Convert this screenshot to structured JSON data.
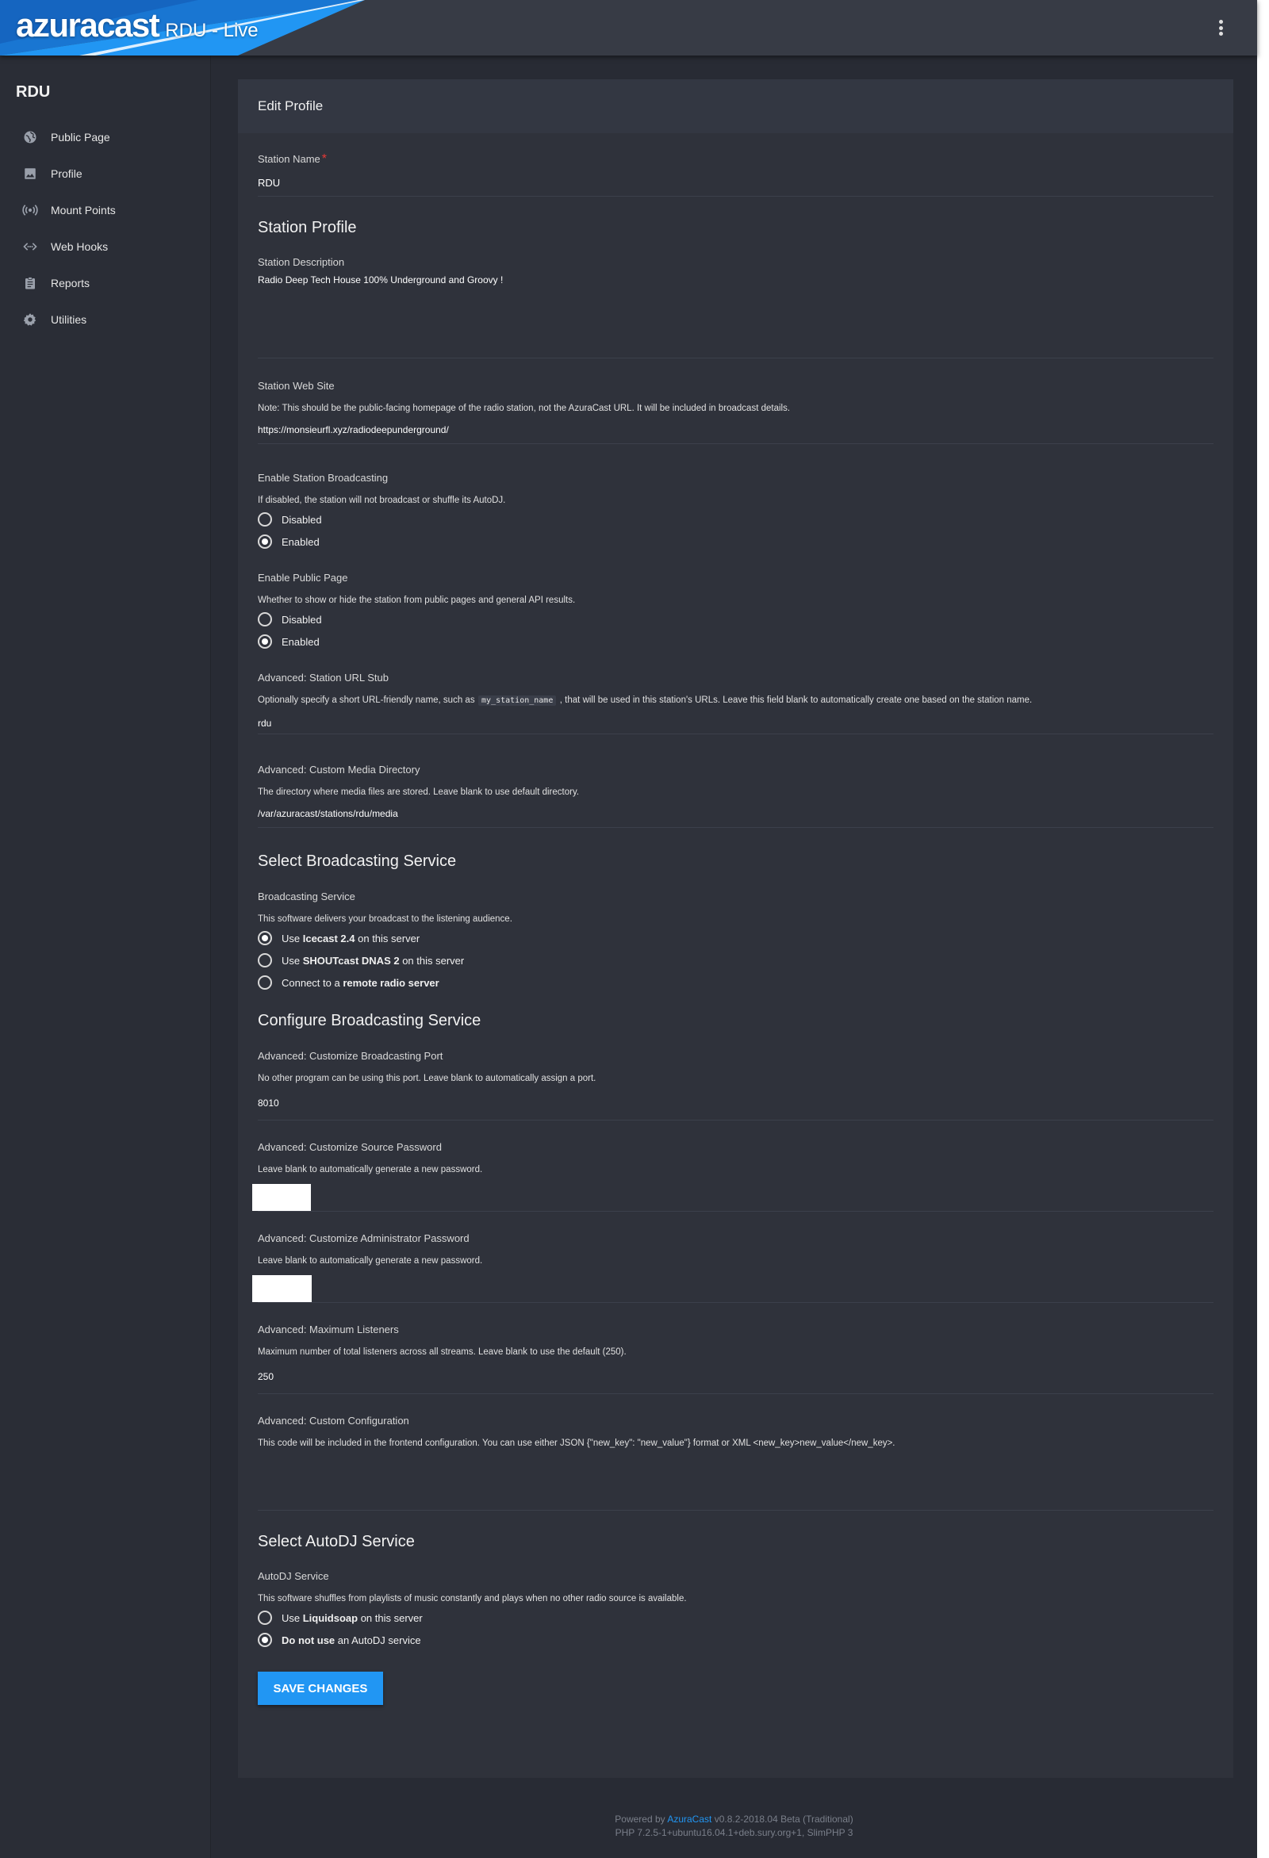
{
  "header": {
    "logo": "azuracast",
    "title": "RDU - Live",
    "menu_icon": "more-vert-icon"
  },
  "sidebar": {
    "station_name": "RDU",
    "items": [
      {
        "label": "Public Page",
        "icon": "globe-icon"
      },
      {
        "label": "Profile",
        "icon": "image-icon"
      },
      {
        "label": "Mount Points",
        "icon": "broadcast-icon"
      },
      {
        "label": "Web Hooks",
        "icon": "code-arrows-icon"
      },
      {
        "label": "Reports",
        "icon": "clipboard-icon"
      },
      {
        "label": "Utilities",
        "icon": "gear-icon"
      }
    ]
  },
  "form": {
    "panel_title": "Edit Profile",
    "station_name": {
      "label": "Station Name",
      "required_mark": "*",
      "value": "RDU"
    },
    "station_profile_title": "Station Profile",
    "description": {
      "label": "Station Description",
      "value": "Radio Deep Tech House 100% Underground and Groovy !"
    },
    "website": {
      "label": "Station Web Site",
      "help": "Note: This should be the public-facing homepage of the radio station, not the AzuraCast URL. It will be included in broadcast details.",
      "value": "https://monsieurfl.xyz/radiodeepunderground/"
    },
    "broadcasting": {
      "label": "Enable Station Broadcasting",
      "help": "If disabled, the station will not broadcast or shuffle its AutoDJ.",
      "options": [
        "Disabled",
        "Enabled"
      ],
      "selected": "Enabled"
    },
    "public_page": {
      "label": "Enable Public Page",
      "help": "Whether to show or hide the station from public pages and general API results.",
      "options": [
        "Disabled",
        "Enabled"
      ],
      "selected": "Enabled"
    },
    "url_stub": {
      "label": "Advanced: Station URL Stub",
      "help_before": "Optionally specify a short URL-friendly name, such as",
      "help_code": "my_station_name",
      "help_after": ", that will be used in this station's URLs. Leave this field blank to automatically create one based on the station name.",
      "value": "rdu"
    },
    "media_dir": {
      "label": "Advanced: Custom Media Directory",
      "help": "The directory where media files are stored. Leave blank to use default directory.",
      "value": "/var/azuracast/stations/rdu/media"
    },
    "select_broadcasting_title": "Select Broadcasting Service",
    "broadcast_service": {
      "label": "Broadcasting Service",
      "help": "This software delivers your broadcast to the listening audience.",
      "options": [
        {
          "prefix": "Use ",
          "bold": "Icecast 2.4",
          "suffix": " on this server"
        },
        {
          "prefix": "Use ",
          "bold": "SHOUTcast DNAS 2",
          "suffix": " on this server"
        },
        {
          "prefix": "Connect to a ",
          "bold": "remote radio server",
          "suffix": ""
        }
      ],
      "selected_index": 0
    },
    "configure_broadcasting_title": "Configure Broadcasting Service",
    "port": {
      "label": "Advanced: Customize Broadcasting Port",
      "help": "No other program can be using this port. Leave blank to automatically assign a port.",
      "value": "8010"
    },
    "source_password": {
      "label": "Advanced: Customize Source Password",
      "help": "Leave blank to automatically generate a new password."
    },
    "admin_password": {
      "label": "Advanced: Customize Administrator Password",
      "help": "Leave blank to automatically generate a new password."
    },
    "max_listeners": {
      "label": "Advanced: Maximum Listeners",
      "help": "Maximum number of total listeners across all streams. Leave blank to use the default (250).",
      "value": "250"
    },
    "custom_config": {
      "label": "Advanced: Custom Configuration",
      "help": "This code will be included in the frontend configuration. You can use either JSON {\"new_key\": \"new_value\"} format or XML <new_key>new_value</new_key>."
    },
    "select_autodj_title": "Select AutoDJ Service",
    "autodj": {
      "label": "AutoDJ Service",
      "help": "This software shuffles from playlists of music constantly and plays when no other radio source is available.",
      "options": [
        {
          "prefix": "Use ",
          "bold": "Liquidsoap",
          "suffix": " on this server"
        },
        {
          "prefix": "",
          "bold": "Do not use",
          "suffix": " an AutoDJ service"
        }
      ],
      "selected_index": 1
    },
    "save_label": "SAVE CHANGES"
  },
  "footer": {
    "powered_by": "Powered by",
    "brand": "AzuraCast",
    "version": "v0.8.2-2018.04 Beta (Traditional)",
    "php": "PHP 7.2.5-1+ubuntu16.04.1+deb.sury.org+1, SlimPHP 3"
  },
  "colors": {
    "background": "#282b34",
    "panel": "#2f323b",
    "accent": "#2196f3",
    "required": "#e53935"
  }
}
